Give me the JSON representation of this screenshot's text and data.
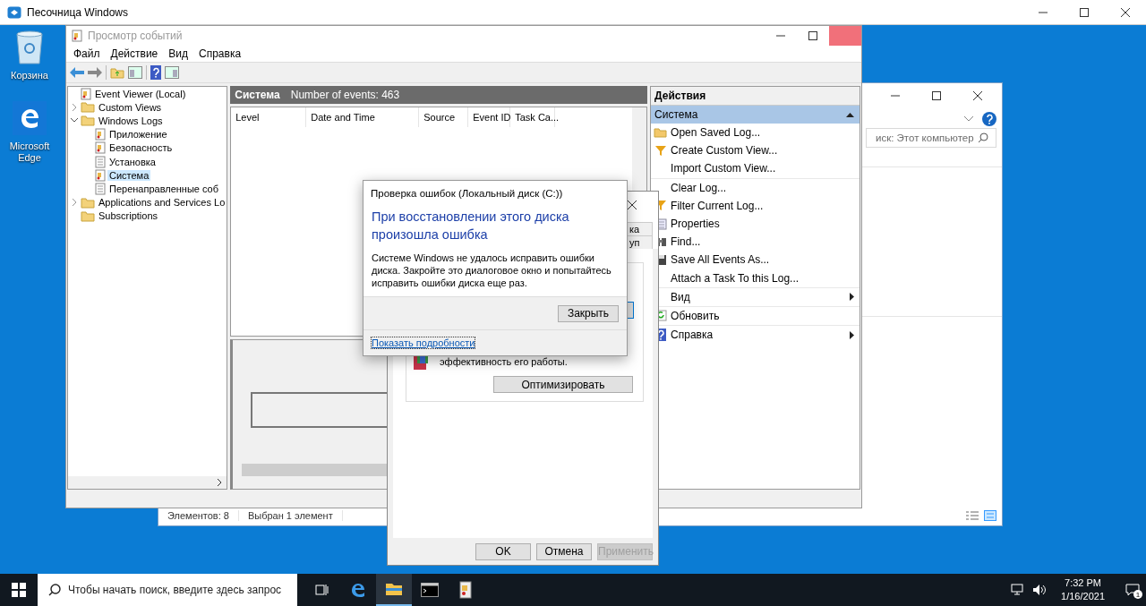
{
  "sandbox": {
    "title": "Песочница Windows"
  },
  "desktop_icons": [
    {
      "kind": "recycle-bin",
      "label": "Корзина"
    },
    {
      "kind": "edge",
      "label": "Microsoft Edge"
    }
  ],
  "explorer": {
    "search_placeholder": "иск: Этот компьютер",
    "status_items": [
      "Элементов: 8",
      "Выбран 1 элемент"
    ]
  },
  "event_viewer": {
    "title": "Просмотр событий",
    "menu": [
      "Файл",
      "Действие",
      "Вид",
      "Справка"
    ],
    "tree": [
      {
        "label": "Event Viewer (Local)",
        "kind": "root",
        "selected": false
      },
      {
        "label": "Custom Views",
        "kind": "folder",
        "expanded": false,
        "selected": false
      },
      {
        "label": "Windows Logs",
        "kind": "folder",
        "expanded": true,
        "selected": false,
        "children": [
          {
            "label": "Приложение",
            "kind": "log",
            "selected": false
          },
          {
            "label": "Безопасность",
            "kind": "log",
            "selected": false
          },
          {
            "label": "Установка",
            "kind": "plain-log",
            "selected": false
          },
          {
            "label": "Система",
            "kind": "log",
            "selected": true
          },
          {
            "label": "Перенаправленные соб",
            "kind": "plain-log",
            "selected": false
          }
        ]
      },
      {
        "label": "Applications and Services Lo",
        "kind": "folder",
        "expanded": false,
        "selected": false
      },
      {
        "label": "Subscriptions",
        "kind": "folder",
        "selected": false
      }
    ],
    "log_header": {
      "name": "Система",
      "count": "Number of events: 463"
    },
    "columns": [
      "Level",
      "Date and Time",
      "Source",
      "Event ID",
      "Task Ca..."
    ],
    "actions_title": "Действия",
    "actions_section": "Система",
    "actions": [
      {
        "label": "Open Saved Log...",
        "kind": "open",
        "separator_before": false,
        "submenu": false
      },
      {
        "label": "Create Custom View...",
        "kind": "filter",
        "separator_before": false,
        "submenu": false
      },
      {
        "label": "Import Custom View...",
        "kind": "none",
        "separator_before": false,
        "submenu": false
      },
      {
        "label": "Clear Log...",
        "kind": "none",
        "separator_before": true,
        "submenu": false
      },
      {
        "label": "Filter Current Log...",
        "kind": "filter",
        "separator_before": false,
        "submenu": false
      },
      {
        "label": "Properties",
        "kind": "properties",
        "separator_before": false,
        "submenu": false
      },
      {
        "label": "Find...",
        "kind": "find",
        "separator_before": false,
        "submenu": false
      },
      {
        "label": "Save All Events As...",
        "kind": "save",
        "separator_before": false,
        "submenu": false
      },
      {
        "label": "Attach a Task To this Log...",
        "kind": "none",
        "separator_before": false,
        "submenu": false
      },
      {
        "label": "Вид",
        "kind": "none",
        "separator_before": true,
        "submenu": true
      },
      {
        "label": "Обновить",
        "kind": "refresh",
        "separator_before": true,
        "submenu": false
      },
      {
        "label": "Справка",
        "kind": "help",
        "separator_before": true,
        "submenu": true
      }
    ]
  },
  "properties_dialog": {
    "tab_fragments": [
      "ка",
      "уп"
    ],
    "description": "эффективность его работы.",
    "optimize_button": "Оптимизировать",
    "buttons": [
      {
        "label": "OK",
        "disabled": false
      },
      {
        "label": "Отмена",
        "disabled": false
      },
      {
        "label": "Применить",
        "disabled": true
      }
    ]
  },
  "error_dialog": {
    "title": "Проверка ошибок (Локальный диск (C:))",
    "heading": "При восстановлении этого диска произошла ошибка",
    "message": "Системе Windows не удалось исправить ошибки диска. Закройте это диалоговое окно и попытайтесь исправить ошибки диска еще раз.",
    "close_button": "Закрыть",
    "details_link": "Показать подробности"
  },
  "taskbar": {
    "search_placeholder": "Чтобы начать поиск, введите здесь запрос",
    "apps": [
      {
        "kind": "task-view",
        "active": false
      },
      {
        "kind": "edge",
        "active": false
      },
      {
        "kind": "folder",
        "active": true
      },
      {
        "kind": "terminal",
        "active": false
      },
      {
        "kind": "event-viewer",
        "active": false
      }
    ],
    "time": "7:32 PM",
    "date": "1/16/2021",
    "notification_count": "1"
  }
}
